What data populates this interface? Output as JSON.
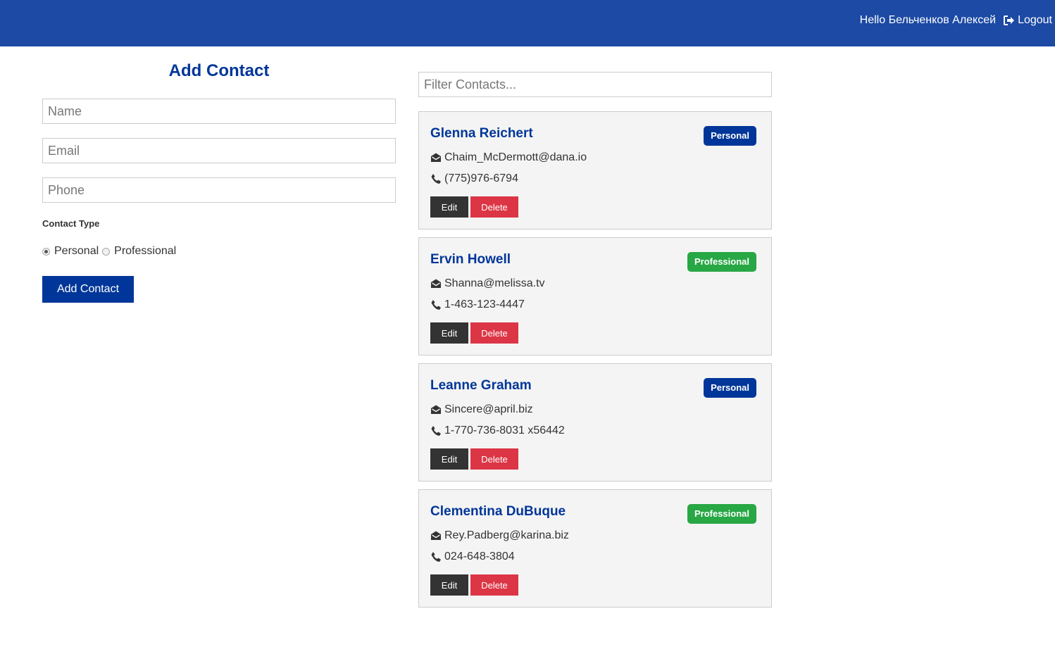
{
  "navbar": {
    "greeting": "Hello Бельченков Алексей",
    "logout_label": "Logout",
    "logout_icon": "sign-out-icon",
    "background": "#1c4aa4"
  },
  "form": {
    "title": "Add Contact",
    "name_placeholder": "Name",
    "email_placeholder": "Email",
    "phone_placeholder": "Phone",
    "contact_type_label": "Contact Type",
    "type_personal": "Personal",
    "type_professional": "Professional",
    "selected_type": "Personal",
    "submit_label": "Add Contact"
  },
  "filter": {
    "placeholder": "Filter Contacts..."
  },
  "contacts": [
    {
      "name": "Glenna Reichert",
      "type": "Personal",
      "email": "Chaim_McDermott@dana.io",
      "phone": "(775)976-6794",
      "edit_label": "Edit",
      "delete_label": "Delete"
    },
    {
      "name": "Ervin Howell",
      "type": "Professional",
      "email": "Shanna@melissa.tv",
      "phone": "1-463-123-4447",
      "edit_label": "Edit",
      "delete_label": "Delete"
    },
    {
      "name": "Leanne Graham",
      "type": "Personal",
      "email": "Sincere@april.biz",
      "phone": "1-770-736-8031 x56442",
      "edit_label": "Edit",
      "delete_label": "Delete"
    },
    {
      "name": "Clementina DuBuque",
      "type": "Professional",
      "email": "Rey.Padberg@karina.biz",
      "phone": "024-648-3804",
      "edit_label": "Edit",
      "delete_label": "Delete"
    }
  ],
  "icons": {
    "email": "envelope-open-icon",
    "phone": "phone-icon"
  },
  "colors": {
    "primary": "#003699",
    "success": "#28a745",
    "danger": "#dc3545",
    "dark": "#333333"
  }
}
